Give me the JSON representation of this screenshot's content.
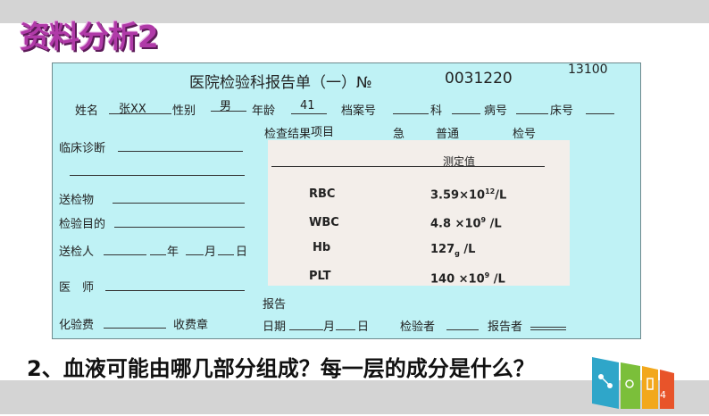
{
  "slide_title": "资料分析2",
  "report": {
    "title": "医院检验科报告单（一）№",
    "number": "0031220",
    "corner_code": "13100",
    "patient": {
      "name_label": "姓名",
      "name_value": "张XX",
      "gender_label": "性别",
      "gender_value": "男",
      "age_label": "年龄",
      "age_value": "41",
      "file_label": "档案号",
      "dept_label": "科",
      "ward_label": "病号",
      "bed_label": "床号"
    },
    "left": {
      "clinical_diagnosis": "临床诊断",
      "specimen": "送检物",
      "purpose": "检验目的",
      "sender": "送检人",
      "year": "年",
      "month": "月",
      "day": "日",
      "doctor": "医　师",
      "fee": "化验费",
      "fee_seal": "收费章"
    },
    "results_header": {
      "item_label": "检查结果",
      "item_overlap": "项目",
      "urgent": "急",
      "normal": "普通",
      "test_no": "检号",
      "measured_value": "测定值"
    },
    "results": [
      {
        "item": "RBC",
        "value_main": "3.59×10",
        "value_sup": "12",
        "value_tail": "/L"
      },
      {
        "item": "WBC",
        "value_main": "4.8 ×10",
        "value_sup": "9",
        "value_tail": " /L"
      },
      {
        "item": "Hb",
        "value_main": "127",
        "value_sub": "g",
        "value_tail": " /L"
      },
      {
        "item": "PLT",
        "value_main": "140 ×10",
        "value_sup": "9",
        "value_tail": " /L"
      }
    ],
    "footer": {
      "report_label": "报告",
      "date_label": "日期",
      "month": "月",
      "day": "日",
      "examiner": "检验者",
      "reporter": "报告者"
    }
  },
  "question": "2、血液可能由哪几部分组成？每一层的成分是什么？",
  "logo": {
    "page_number": "4",
    "colors": [
      "#2fa6c9",
      "#7bbf3a",
      "#f2a81d",
      "#e8542a"
    ]
  }
}
